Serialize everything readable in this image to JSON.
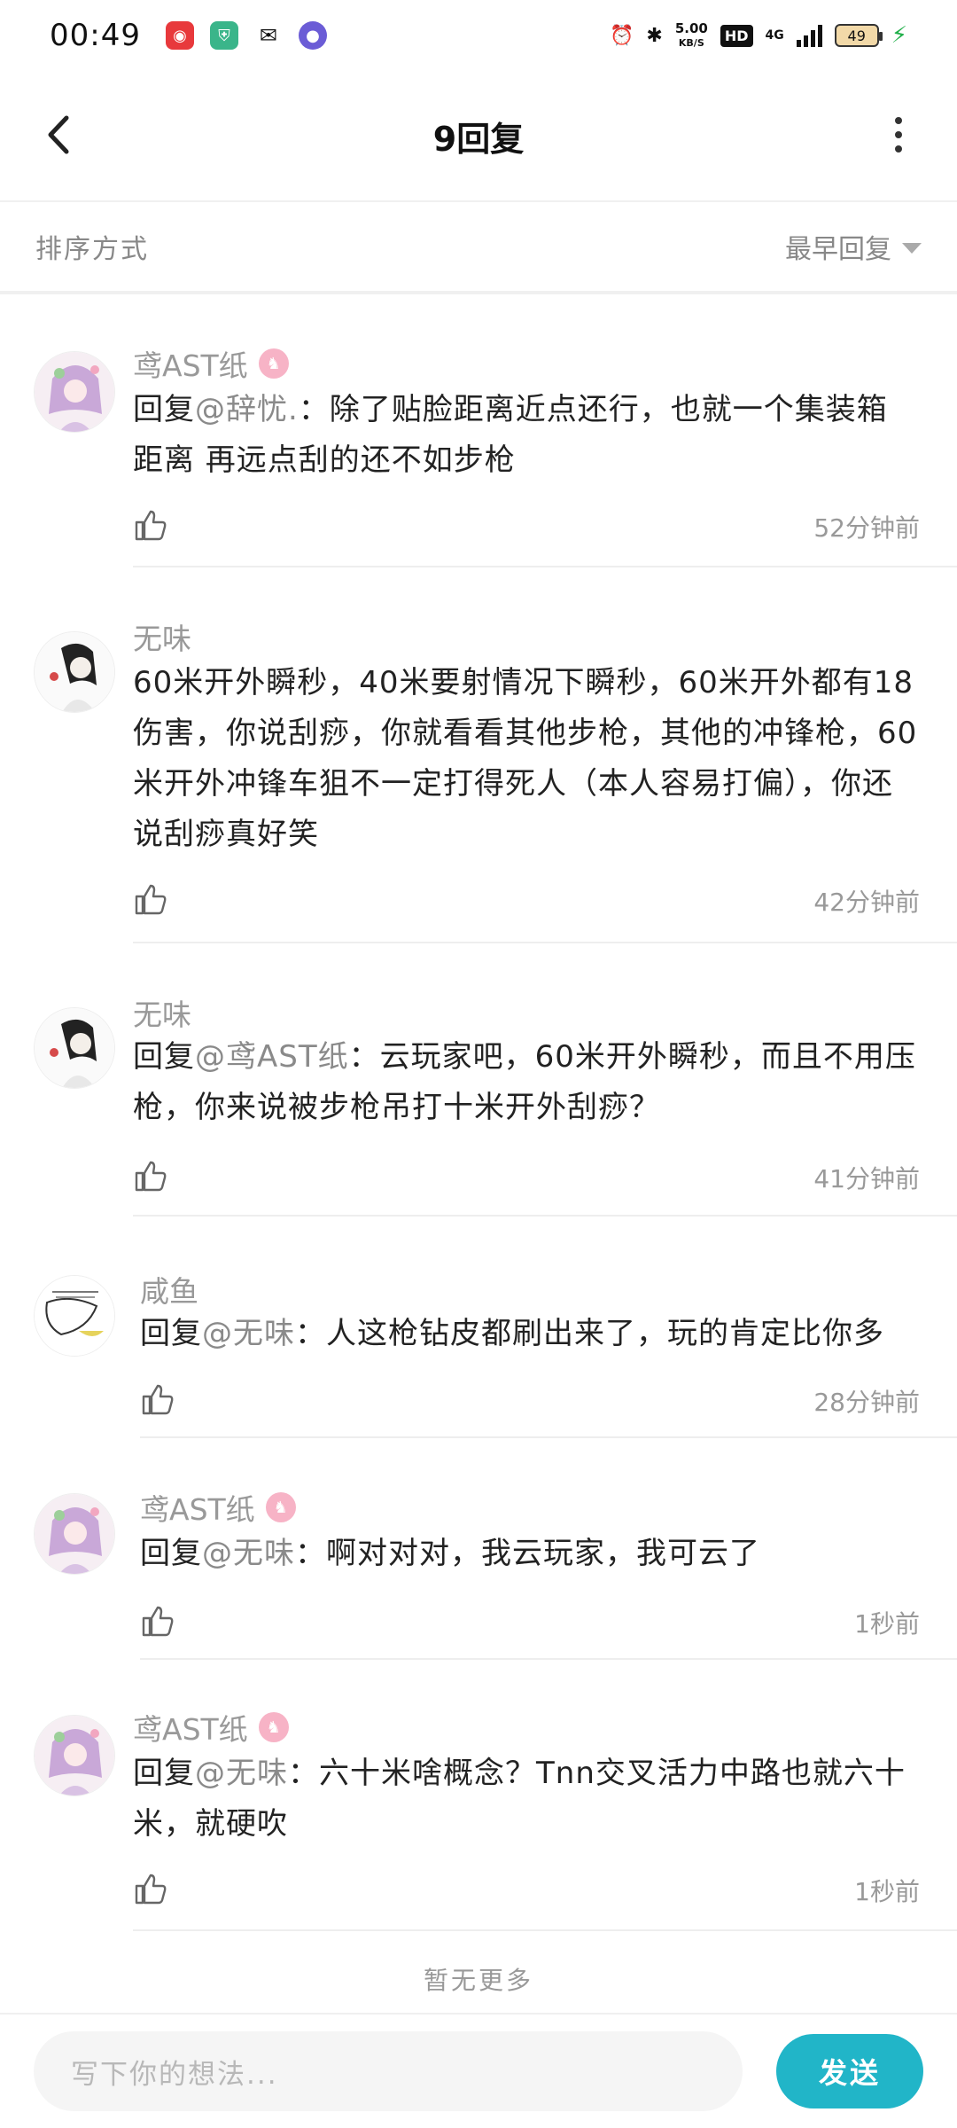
{
  "status_bar": {
    "time": "00:49",
    "net_speed_value": "5.00",
    "net_speed_unit": "KB/S",
    "hd": "HD",
    "network": "4G",
    "battery": "49"
  },
  "header": {
    "title": "9回复"
  },
  "sort_bar": {
    "label": "排序方式",
    "selected": "最早回复"
  },
  "comments": [
    {
      "author": "鸢AST纸",
      "has_badge": true,
      "reply_prefix": "回复",
      "reply_to": "@辞忧.",
      "body": "：除了贴脸距离近点还行，也就一个集装箱距离 再远点刮的还不如步枪",
      "time": "52分钟前"
    },
    {
      "author": "无味",
      "has_badge": false,
      "reply_prefix": "",
      "reply_to": "",
      "body": "60米开外瞬秒，40米要射情况下瞬秒，60米开外都有18伤害，你说刮痧，你就看看其他步枪，其他的冲锋枪，60米开外冲锋车狙不一定打得死人（本人容易打偏），你还说刮痧真好笑",
      "time": "42分钟前"
    },
    {
      "author": "无味",
      "has_badge": false,
      "reply_prefix": "回复",
      "reply_to": "@鸢AST纸",
      "body": "：云玩家吧，60米开外瞬秒，而且不用压枪，你来说被步枪吊打十米开外刮痧？",
      "time": "41分钟前"
    },
    {
      "author": "咸鱼",
      "has_badge": false,
      "reply_prefix": "回复",
      "reply_to": "@无味",
      "body": "：人这枪钻皮都刷出来了，玩的肯定比你多",
      "time": "28分钟前"
    },
    {
      "author": "鸢AST纸",
      "has_badge": true,
      "reply_prefix": "回复",
      "reply_to": "@无味",
      "body": "：啊对对对，我云玩家，我可云了",
      "time": "1秒前"
    },
    {
      "author": "鸢AST纸",
      "has_badge": true,
      "reply_prefix": "回复",
      "reply_to": "@无味",
      "body": "：六十米啥概念？Tnn交叉活力中路也就六十米，就硬吹",
      "time": "1秒前"
    }
  ],
  "footer": {
    "no_more": "暂无更多"
  },
  "input": {
    "placeholder": "写下你的想法...",
    "send_label": "发送"
  },
  "colors": {
    "accent": "#21b5c8",
    "badge": "#f7b3c6",
    "charging": "#22b04b"
  },
  "icons": [
    "back-icon",
    "more-icon",
    "caret-down-icon",
    "like-icon",
    "avatar"
  ]
}
